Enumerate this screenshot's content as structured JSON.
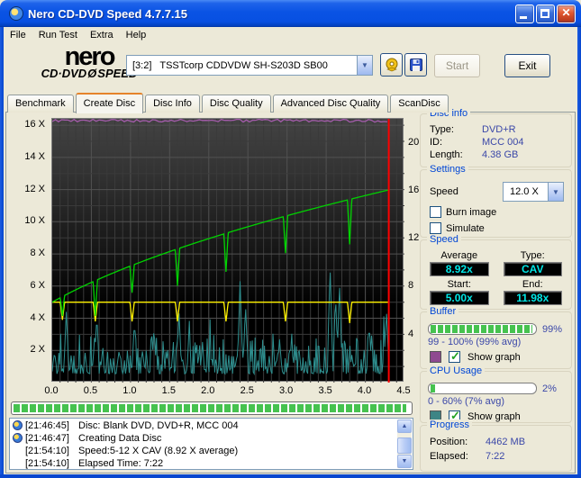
{
  "window": {
    "title": "Nero CD-DVD Speed 4.7.7.15"
  },
  "icons": {
    "close_glyph": "✕",
    "combo_arrow": "▼",
    "scroll_up": "▲",
    "scroll_down": "▼",
    "check": "✓"
  },
  "menu": [
    "File",
    "Run Test",
    "Extra",
    "Help"
  ],
  "toolbar": {
    "logo_top": "nero",
    "logo_bottom_left": "CD·DVD",
    "logo_disc": "Ø",
    "logo_bottom_right": "SPEED",
    "drive_combo_value": "[3:2]   TSSTcorp CDDVDW SH-S203D SB00",
    "start_label": "Start",
    "exit_label": "Exit"
  },
  "tabs": [
    {
      "label": "Benchmark",
      "active": false
    },
    {
      "label": "Create Disc",
      "active": true
    },
    {
      "label": "Disc Info",
      "active": false
    },
    {
      "label": "Disc Quality",
      "active": false
    },
    {
      "label": "Advanced Disc Quality",
      "active": false
    },
    {
      "label": "ScanDisc",
      "active": false
    }
  ],
  "chart_data": {
    "type": "line",
    "x_unit": "GB",
    "x_range": [
      0,
      4.5
    ],
    "x_ticks": [
      "0.0",
      "0.5",
      "1.0",
      "1.5",
      "2.0",
      "2.5",
      "3.0",
      "3.5",
      "4.0",
      "4.5"
    ],
    "y_left_range": [
      0,
      16.4
    ],
    "y_left_ticks": [
      16,
      14,
      12,
      10,
      8,
      6,
      4,
      2
    ],
    "y_left_suffix": " X",
    "y_right_range": [
      0,
      22
    ],
    "y_right_ticks": [
      20,
      16,
      12,
      8,
      4
    ],
    "end_gb": 4.3,
    "grid_minor": "#3A3A3A",
    "grid_major": "#525252",
    "position_marker_gb": 4.3,
    "marker_color": "#FF0000",
    "series": [
      {
        "name": "buffer-level",
        "kind": "buffer_pct",
        "color": "#A55CAC",
        "level_pct": 99.3,
        "seed": 9
      },
      {
        "name": "cpu-usage",
        "kind": "noise",
        "color": "#2E8F8F",
        "base_x": 0.55,
        "noise_x": 2.5,
        "seed": 12,
        "spikes": [
          [
            0.18,
            4.4
          ],
          [
            0.57,
            4.2
          ],
          [
            1.05,
            3.8
          ],
          [
            1.3,
            3.4
          ],
          [
            1.62,
            4.3
          ],
          [
            2.4,
            6.3
          ],
          [
            2.47,
            4.8
          ],
          [
            3.55,
            7.2
          ],
          [
            3.62,
            5.4
          ],
          [
            3.67,
            6.2
          ],
          [
            4.05,
            3.6
          ],
          [
            4.27,
            4.5
          ]
        ]
      },
      {
        "name": "requested-speed",
        "kind": "flat",
        "color": "#FFF200",
        "level_x": 5.0,
        "dip_width_gb": 0.028,
        "dips": [
          [
            0.13,
            1.1
          ],
          [
            0.55,
            1.2
          ],
          [
            1.02,
            1.2
          ],
          [
            1.6,
            1.2
          ],
          [
            2.22,
            1.2
          ],
          [
            2.98,
            1.2
          ],
          [
            3.8,
            1.3
          ]
        ]
      },
      {
        "name": "write-speed",
        "kind": "cav",
        "color": "#00D400",
        "start_x": 5.0,
        "end_x": 11.98,
        "dip_width_gb": 0.028,
        "dips": [
          [
            0.13,
            1.2
          ],
          [
            0.55,
            2.2
          ],
          [
            1.02,
            1.7
          ],
          [
            1.6,
            2.3
          ],
          [
            2.22,
            2.4
          ],
          [
            2.98,
            2.3
          ],
          [
            3.8,
            2.8
          ]
        ]
      }
    ]
  },
  "burn_progress": {
    "percent": 99
  },
  "log": [
    {
      "icon": true,
      "time": "[21:46:45]",
      "text": "Disc: Blank DVD, DVD+R, MCC 004"
    },
    {
      "icon": true,
      "time": "[21:46:47]",
      "text": "Creating Data Disc"
    },
    {
      "icon": false,
      "time": "[21:54:10]",
      "text": "Speed:5-12 X CAV (8.92 X average)"
    },
    {
      "icon": false,
      "time": "[21:54:10]",
      "text": "Elapsed Time:  7:22"
    }
  ],
  "sidebar": {
    "disc_info": {
      "title": "Disc info",
      "rows": [
        [
          "Type:",
          "DVD+R"
        ],
        [
          "ID:",
          "MCC 004"
        ],
        [
          "Length:",
          "4.38 GB"
        ]
      ]
    },
    "settings": {
      "title": "Settings",
      "speed_label": "Speed",
      "speed_value": "12.0 X",
      "checkboxes": [
        {
          "label": "Burn image",
          "checked": false
        },
        {
          "label": "Simulate",
          "checked": false
        }
      ]
    },
    "speed": {
      "title": "Speed",
      "cells": [
        {
          "label": "Average",
          "value": "8.92x"
        },
        {
          "label": "Type:",
          "value": "CAV"
        },
        {
          "label": "Start:",
          "value": "5.00x"
        },
        {
          "label": "End:",
          "value": "11.98x"
        }
      ]
    },
    "buffer": {
      "title": "Buffer",
      "percent": 98,
      "percent_label": "99%",
      "range_label": "99 - 100% (99% avg)",
      "swatch_color": "#8F4A90",
      "show_graph_label": "Show graph",
      "show_graph_checked": true
    },
    "cpu": {
      "title": "CPU Usage",
      "percent": 4,
      "percent_label": "2%",
      "range_label": "0 - 60% (7% avg)",
      "swatch_color": "#3E8585",
      "show_graph_label": "Show graph",
      "show_graph_checked": true
    },
    "progress": {
      "title": "Progress",
      "rows": [
        [
          "Position:",
          "4462 MB"
        ],
        [
          "Elapsed:",
          "7:22"
        ]
      ]
    }
  }
}
